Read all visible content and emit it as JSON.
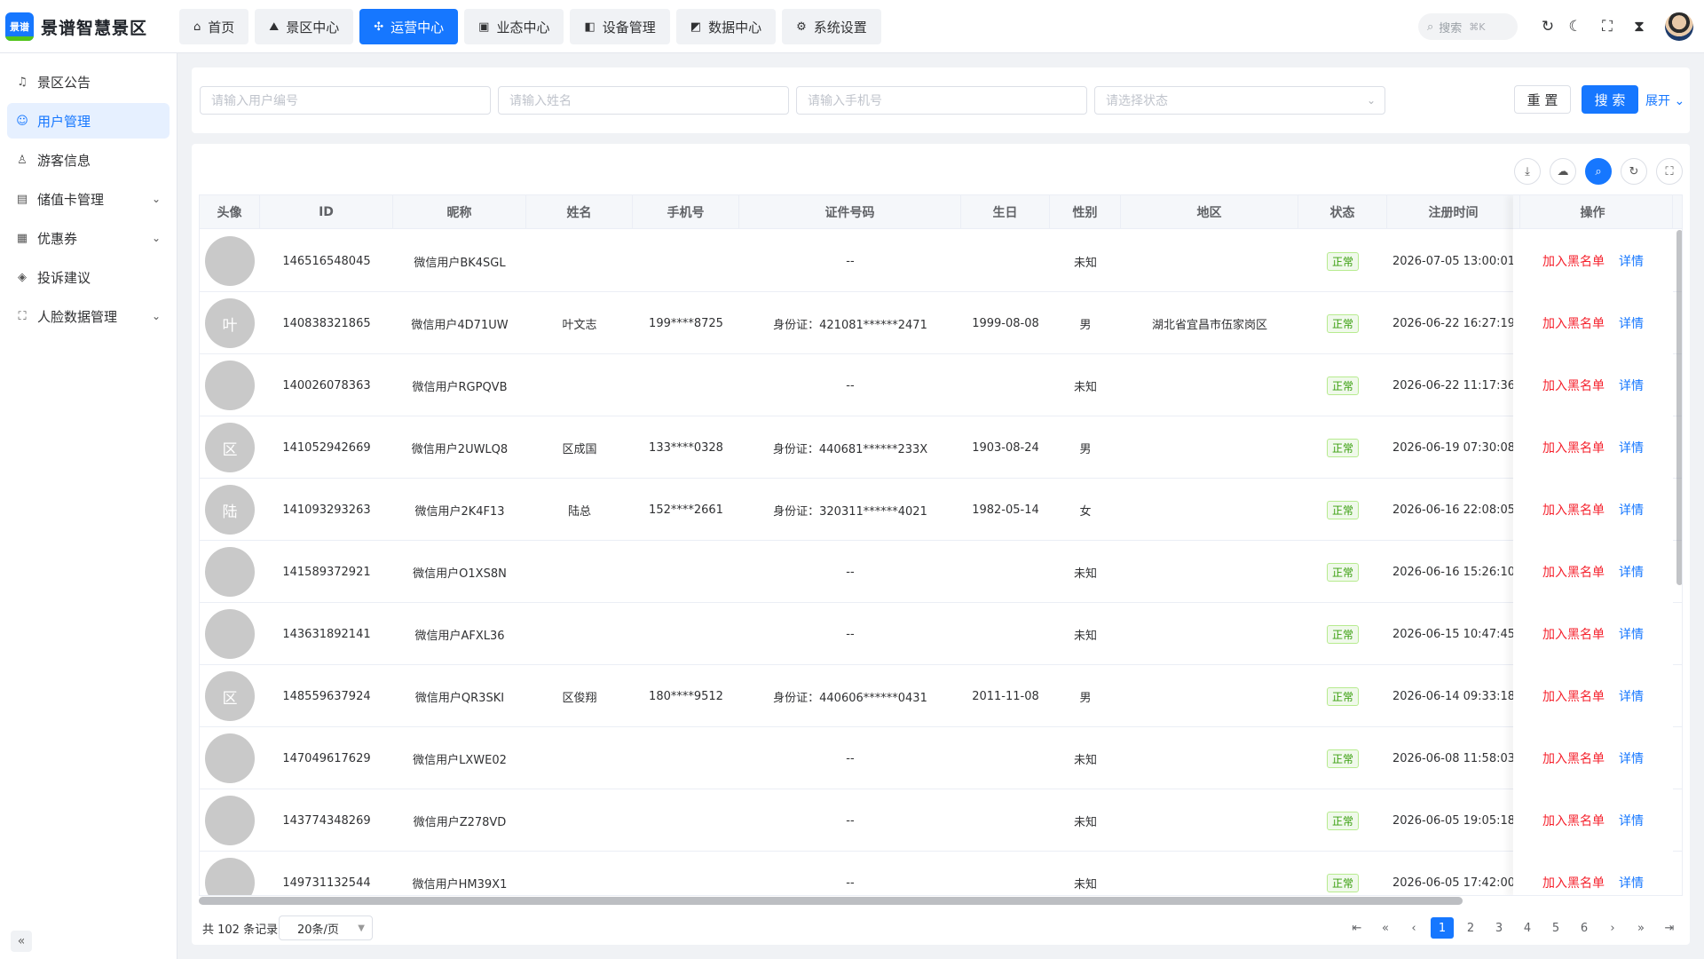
{
  "app": {
    "logo_mark": "景谱",
    "title": "景谱智慧景区"
  },
  "nav": [
    {
      "icon": "⌂",
      "label": "首页"
    },
    {
      "icon": "⛰",
      "label": "景区中心"
    },
    {
      "icon": "✣",
      "label": "运营中心",
      "active": true
    },
    {
      "icon": "▣",
      "label": "业态中心"
    },
    {
      "icon": "◧",
      "label": "设备管理"
    },
    {
      "icon": "◩",
      "label": "数据中心"
    },
    {
      "icon": "⚙",
      "label": "系统设置"
    }
  ],
  "header": {
    "search_placeholder": "搜索",
    "search_shortcut": "⌘K"
  },
  "sidebar": [
    {
      "icon": "♫",
      "label": "景区公告",
      "chevron": ""
    },
    {
      "icon": "☺",
      "label": "用户管理",
      "active": true,
      "chevron": ""
    },
    {
      "icon": "♙",
      "label": "游客信息",
      "chevron": ""
    },
    {
      "icon": "▤",
      "label": "储值卡管理",
      "chevron": "⌄"
    },
    {
      "icon": "▦",
      "label": "优惠券",
      "chevron": "⌄"
    },
    {
      "icon": "◈",
      "label": "投诉建议",
      "chevron": ""
    },
    {
      "icon": "⛶",
      "label": "人脸数据管理",
      "chevron": "⌄"
    }
  ],
  "filters": {
    "user_id_placeholder": "请输入用户编号",
    "name_placeholder": "请输入姓名",
    "phone_placeholder": "请输入手机号",
    "status_placeholder": "请选择状态",
    "reset_label": "重 置",
    "search_label": "搜 索",
    "expand_label": "展开"
  },
  "table": {
    "columns": [
      "头像",
      "ID",
      "昵称",
      "姓名",
      "手机号",
      "证件号码",
      "生日",
      "性别",
      "地区",
      "状态",
      "注册时间",
      "操作"
    ],
    "blacklist_label": "加入黑名单",
    "detail_label": "详情",
    "rows": [
      {
        "avatar": "",
        "id": "146516548045",
        "nickname": "微信用户BK4SGL",
        "name": "",
        "phone": "",
        "idcard": "--",
        "birthday": "",
        "gender": "未知",
        "region": "",
        "status": "正常",
        "registered": "2026-07-05 13:00:01"
      },
      {
        "avatar": "叶",
        "id": "140838321865",
        "nickname": "微信用户4D71UW",
        "name": "叶文志",
        "phone": "199****8725",
        "idcard": "身份证：421081******2471",
        "birthday": "1999-08-08",
        "gender": "男",
        "region": "湖北省宜昌市伍家岗区",
        "status": "正常",
        "registered": "2026-06-22 16:27:19"
      },
      {
        "avatar": "",
        "id": "140026078363",
        "nickname": "微信用户RGPQVB",
        "name": "",
        "phone": "",
        "idcard": "--",
        "birthday": "",
        "gender": "未知",
        "region": "",
        "status": "正常",
        "registered": "2026-06-22 11:17:36"
      },
      {
        "avatar": "区",
        "id": "141052942669",
        "nickname": "微信用户2UWLQ8",
        "name": "区成国",
        "phone": "133****0328",
        "idcard": "身份证：440681******233X",
        "birthday": "1903-08-24",
        "gender": "男",
        "region": "",
        "status": "正常",
        "registered": "2026-06-19 07:30:08"
      },
      {
        "avatar": "陆",
        "id": "141093293263",
        "nickname": "微信用户2K4F13",
        "name": "陆总",
        "phone": "152****2661",
        "idcard": "身份证：320311******4021",
        "birthday": "1982-05-14",
        "gender": "女",
        "region": "",
        "status": "正常",
        "registered": "2026-06-16 22:08:05"
      },
      {
        "avatar": "",
        "id": "141589372921",
        "nickname": "微信用户O1XS8N",
        "name": "",
        "phone": "",
        "idcard": "--",
        "birthday": "",
        "gender": "未知",
        "region": "",
        "status": "正常",
        "registered": "2026-06-16 15:26:10"
      },
      {
        "avatar": "",
        "id": "143631892141",
        "nickname": "微信用户AFXL36",
        "name": "",
        "phone": "",
        "idcard": "--",
        "birthday": "",
        "gender": "未知",
        "region": "",
        "status": "正常",
        "registered": "2026-06-15 10:47:45"
      },
      {
        "avatar": "区",
        "id": "148559637924",
        "nickname": "微信用户QR3SKI",
        "name": "区俊翔",
        "phone": "180****9512",
        "idcard": "身份证：440606******0431",
        "birthday": "2011-11-08",
        "gender": "男",
        "region": "",
        "status": "正常",
        "registered": "2026-06-14 09:33:18"
      },
      {
        "avatar": "",
        "id": "147049617629",
        "nickname": "微信用户LXWE02",
        "name": "",
        "phone": "",
        "idcard": "--",
        "birthday": "",
        "gender": "未知",
        "region": "",
        "status": "正常",
        "registered": "2026-06-08 11:58:03"
      },
      {
        "avatar": "",
        "id": "143774348269",
        "nickname": "微信用户Z278VD",
        "name": "",
        "phone": "",
        "idcard": "--",
        "birthday": "",
        "gender": "未知",
        "region": "",
        "status": "正常",
        "registered": "2026-06-05 19:05:18"
      },
      {
        "avatar": "",
        "id": "149731132544",
        "nickname": "微信用户HM39X1",
        "name": "",
        "phone": "",
        "idcard": "--",
        "birthday": "",
        "gender": "未知",
        "region": "",
        "status": "正常",
        "registered": "2026-06-05 17:42:00"
      }
    ]
  },
  "pagination": {
    "total_label": "共 102 条记录",
    "page_size": "20条/页",
    "pages": [
      "1",
      "2",
      "3",
      "4",
      "5",
      "6"
    ],
    "current": "1"
  },
  "colors": {
    "primary": "#1677ff",
    "danger": "#f5222d",
    "success": "#389e0d"
  }
}
